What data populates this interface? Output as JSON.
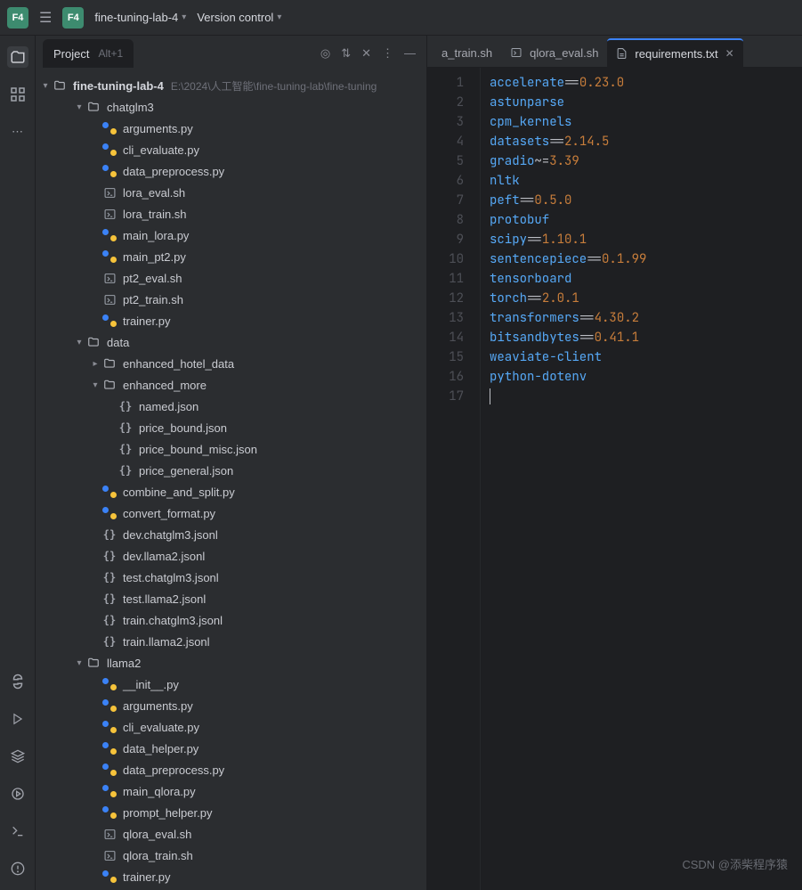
{
  "header": {
    "badge": "F4",
    "project": "fine-tuning-lab-4",
    "vc": "Version control"
  },
  "panel": {
    "title": "Project",
    "shortcut": "Alt+1"
  },
  "tree": {
    "root": {
      "name": "fine-tuning-lab-4",
      "path": "E:\\2024\\人工智能\\fine-tuning-lab\\fine-tuning"
    },
    "items": [
      {
        "d": 1,
        "arrow": "down",
        "icon": "folder",
        "name": "chatglm3"
      },
      {
        "d": 2,
        "icon": "py",
        "name": "arguments.py"
      },
      {
        "d": 2,
        "icon": "py",
        "name": "cli_evaluate.py"
      },
      {
        "d": 2,
        "icon": "py",
        "name": "data_preprocess.py"
      },
      {
        "d": 2,
        "icon": "sh",
        "name": "lora_eval.sh"
      },
      {
        "d": 2,
        "icon": "sh",
        "name": "lora_train.sh"
      },
      {
        "d": 2,
        "icon": "py",
        "name": "main_lora.py"
      },
      {
        "d": 2,
        "icon": "py",
        "name": "main_pt2.py"
      },
      {
        "d": 2,
        "icon": "sh",
        "name": "pt2_eval.sh"
      },
      {
        "d": 2,
        "icon": "sh",
        "name": "pt2_train.sh"
      },
      {
        "d": 2,
        "icon": "py",
        "name": "trainer.py"
      },
      {
        "d": 1,
        "arrow": "down",
        "icon": "folder",
        "name": "data"
      },
      {
        "d": 2,
        "arrow": "right",
        "icon": "folder",
        "name": "enhanced_hotel_data"
      },
      {
        "d": 2,
        "arrow": "down",
        "icon": "folder",
        "name": "enhanced_more"
      },
      {
        "d": 3,
        "icon": "json",
        "name": "named.json"
      },
      {
        "d": 3,
        "icon": "json",
        "name": "price_bound.json"
      },
      {
        "d": 3,
        "icon": "json",
        "name": "price_bound_misc.json"
      },
      {
        "d": 3,
        "icon": "json",
        "name": "price_general.json"
      },
      {
        "d": 2,
        "icon": "py",
        "name": "combine_and_split.py"
      },
      {
        "d": 2,
        "icon": "py",
        "name": "convert_format.py"
      },
      {
        "d": 2,
        "icon": "json",
        "name": "dev.chatglm3.jsonl"
      },
      {
        "d": 2,
        "icon": "json",
        "name": "dev.llama2.jsonl"
      },
      {
        "d": 2,
        "icon": "json",
        "name": "test.chatglm3.jsonl"
      },
      {
        "d": 2,
        "icon": "json",
        "name": "test.llama2.jsonl"
      },
      {
        "d": 2,
        "icon": "json",
        "name": "train.chatglm3.jsonl"
      },
      {
        "d": 2,
        "icon": "json",
        "name": "train.llama2.jsonl"
      },
      {
        "d": 1,
        "arrow": "down",
        "icon": "folder",
        "name": "llama2"
      },
      {
        "d": 2,
        "icon": "py",
        "name": "__init__.py"
      },
      {
        "d": 2,
        "icon": "py",
        "name": "arguments.py"
      },
      {
        "d": 2,
        "icon": "py",
        "name": "cli_evaluate.py"
      },
      {
        "d": 2,
        "icon": "py",
        "name": "data_helper.py"
      },
      {
        "d": 2,
        "icon": "py",
        "name": "data_preprocess.py"
      },
      {
        "d": 2,
        "icon": "py",
        "name": "main_qlora.py"
      },
      {
        "d": 2,
        "icon": "py",
        "name": "prompt_helper.py"
      },
      {
        "d": 2,
        "icon": "sh",
        "name": "qlora_eval.sh"
      },
      {
        "d": 2,
        "icon": "sh",
        "name": "qlora_train.sh"
      },
      {
        "d": 2,
        "icon": "py",
        "name": "trainer.py"
      }
    ]
  },
  "tabs": [
    {
      "label": "a_train.sh",
      "active": false
    },
    {
      "label": "qlora_eval.sh",
      "active": false,
      "icon": "sh"
    },
    {
      "label": "requirements.txt",
      "active": true,
      "icon": "txt"
    }
  ],
  "code": [
    {
      "n": 1,
      "t": [
        [
          "id",
          "accelerate"
        ],
        [
          "op",
          "=="
        ],
        [
          "num",
          "0.23.0"
        ]
      ]
    },
    {
      "n": 2,
      "t": [
        [
          "id",
          "astunparse"
        ]
      ]
    },
    {
      "n": 3,
      "t": [
        [
          "id",
          "cpm_kernels"
        ]
      ]
    },
    {
      "n": 4,
      "t": [
        [
          "id",
          "datasets"
        ],
        [
          "op",
          "=="
        ],
        [
          "num",
          "2.14.5"
        ]
      ]
    },
    {
      "n": 5,
      "t": [
        [
          "id",
          "gradio"
        ],
        [
          "op",
          "~="
        ],
        [
          "num",
          "3.39"
        ]
      ]
    },
    {
      "n": 6,
      "t": [
        [
          "id",
          "nltk"
        ]
      ]
    },
    {
      "n": 7,
      "t": [
        [
          "id",
          "peft"
        ],
        [
          "op",
          "=="
        ],
        [
          "num",
          "0.5.0"
        ]
      ]
    },
    {
      "n": 8,
      "t": [
        [
          "id",
          "protobuf"
        ]
      ]
    },
    {
      "n": 9,
      "t": [
        [
          "id",
          "scipy"
        ],
        [
          "op",
          "=="
        ],
        [
          "num",
          "1.10.1"
        ]
      ]
    },
    {
      "n": 10,
      "t": [
        [
          "id",
          "sentencepiece"
        ],
        [
          "op",
          "=="
        ],
        [
          "num",
          "0.1.99"
        ]
      ]
    },
    {
      "n": 11,
      "t": [
        [
          "id",
          "tensorboard"
        ]
      ]
    },
    {
      "n": 12,
      "t": [
        [
          "id",
          "torch"
        ],
        [
          "op",
          "=="
        ],
        [
          "num",
          "2.0.1"
        ]
      ]
    },
    {
      "n": 13,
      "t": [
        [
          "id",
          "transformers"
        ],
        [
          "op",
          "=="
        ],
        [
          "num",
          "4.30.2"
        ]
      ]
    },
    {
      "n": 14,
      "t": [
        [
          "id",
          "bitsandbytes"
        ],
        [
          "op",
          "=="
        ],
        [
          "num",
          "0.41.1"
        ]
      ]
    },
    {
      "n": 15,
      "t": [
        [
          "id",
          "weaviate-client"
        ]
      ]
    },
    {
      "n": 16,
      "t": [
        [
          "id",
          "python-dotenv"
        ]
      ]
    },
    {
      "n": 17,
      "t": []
    }
  ],
  "watermark": "CSDN @添柴程序猿"
}
